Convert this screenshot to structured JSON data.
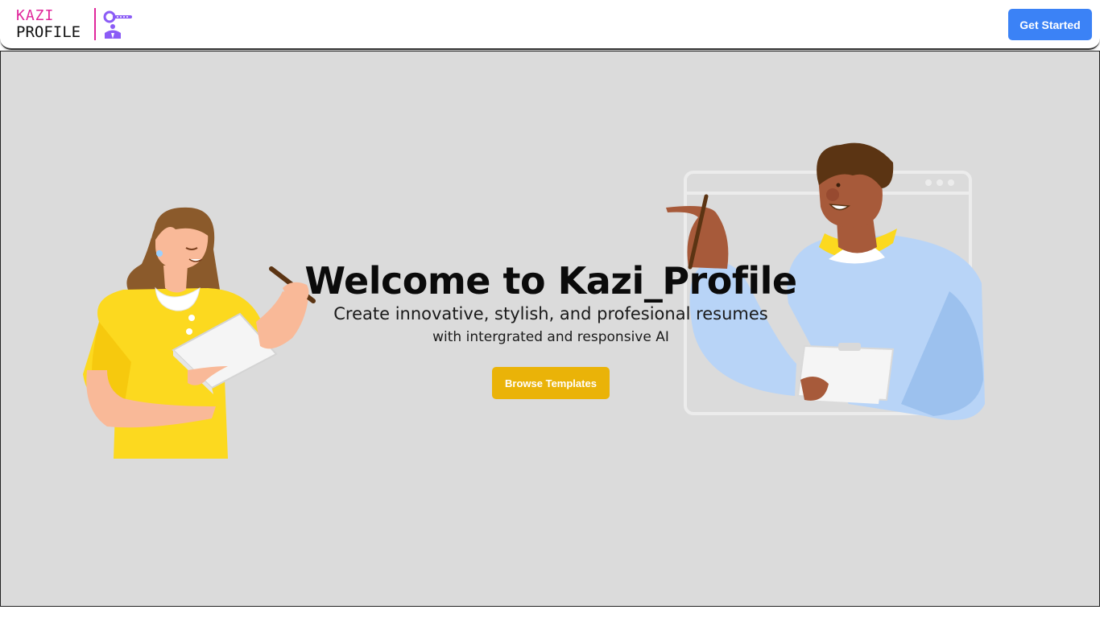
{
  "header": {
    "logo": {
      "line1": "KAZI",
      "line2": "PROFILE",
      "icon": "magnifier-person-icon"
    },
    "cta_label": "Get Started"
  },
  "hero": {
    "title": "Welcome to Kazi_Profile",
    "subtitle": "Create innovative, stylish, and profesional resumes",
    "subtitle2": "with intergrated and responsive AI",
    "button_label": "Browse Templates"
  },
  "colors": {
    "brand_pink": "#e0269b",
    "primary_blue": "#3b82f6",
    "accent_yellow": "#eab308",
    "hero_bg": "#dbdbdb"
  }
}
